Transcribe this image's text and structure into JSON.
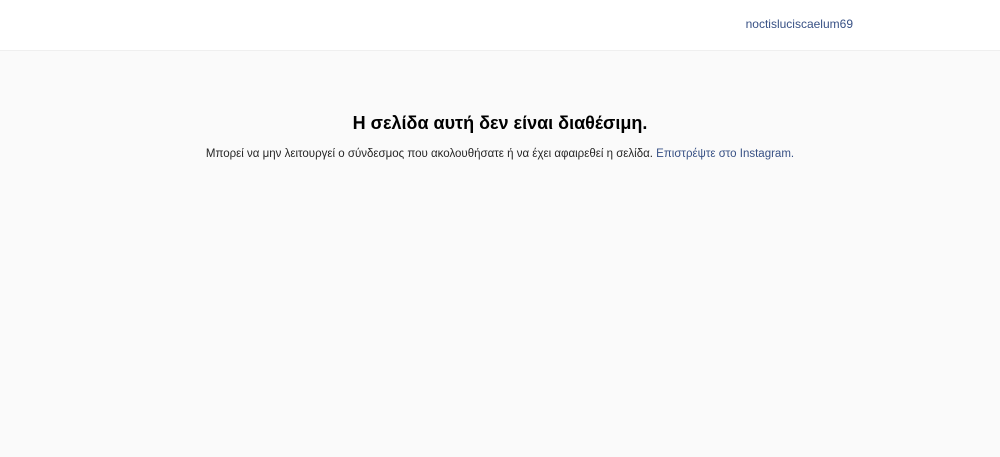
{
  "header": {
    "username": "noctisluciscaelum69"
  },
  "main": {
    "title": "Η σελίδα αυτή δεν είναι διαθέσιμη.",
    "message": "Μπορεί να μην λειτουργεί ο σύνδεσμος που ακολουθήσατε ή να έχει αφαιρεθεί η σελίδα.",
    "return_link": "Επιστρέψτε στο Instagram."
  },
  "colors": {
    "background": "#fafafa",
    "header_background": "#ffffff",
    "link": "#385185",
    "text": "#262626"
  }
}
